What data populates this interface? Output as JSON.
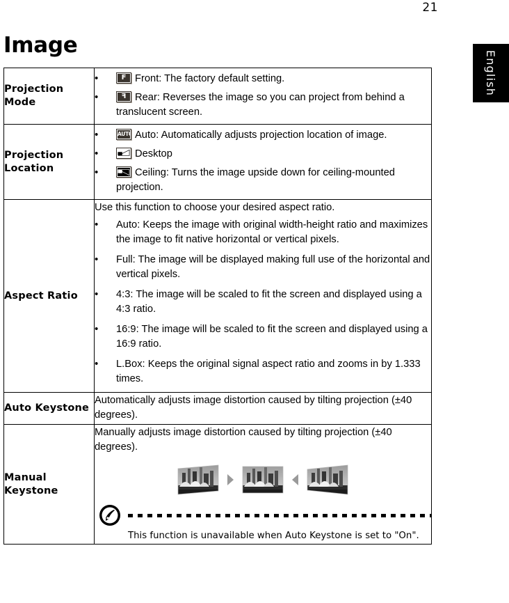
{
  "page": {
    "number": "21",
    "heading": "Image",
    "language_tab": "English"
  },
  "table": {
    "rows": [
      {
        "label": "Projection Mode",
        "bullets": [
          {
            "icon": "projector-front-icon",
            "icon_text": "F",
            "text": "Front: The factory default setting."
          },
          {
            "icon": "projector-rear-icon",
            "icon_text": "F",
            "text": "Rear: Reverses the image so you can project from behind a translucent screen."
          }
        ]
      },
      {
        "label": "Projection Location",
        "bullets": [
          {
            "icon": "projection-auto-icon",
            "icon_text": "AUTO",
            "text": "Auto: Automatically adjusts projection location of image."
          },
          {
            "icon": "projection-desktop-icon",
            "icon_text": "",
            "text": "Desktop"
          },
          {
            "icon": "projection-ceiling-icon",
            "icon_text": "",
            "text": "Ceiling: Turns the image upside down for ceiling-mounted projection."
          }
        ]
      },
      {
        "label": "Aspect  Ratio",
        "intro": "Use this function to choose your desired aspect ratio.",
        "bullets": [
          {
            "text": "Auto: Keeps the image with original width-height ratio and maximizes the image to fit native horizontal or vertical pixels."
          },
          {
            "text": "Full: The image will be displayed making full use of the horizontal and vertical pixels."
          },
          {
            "text": "4:3: The image will be scaled to fit the screen and displayed using a 4:3 ratio."
          },
          {
            "text": "16:9: The image will be scaled to fit the screen and displayed using a 16:9 ratio."
          },
          {
            "text": "L.Box: Keeps the original signal aspect ratio and zooms in by 1.333 times."
          }
        ]
      },
      {
        "label": "Auto Keystone",
        "intro": "Automatically adjusts image distortion caused by tilting projection (±40 degrees)."
      },
      {
        "label": "Manual Keystone",
        "intro": "Manually adjusts image distortion caused by tilting projection (±40 degrees).",
        "keystone_images": [
          {
            "name": "keystone-distorted-left-image"
          },
          {
            "name": "keystone-arrow-right-icon"
          },
          {
            "name": "keystone-corrected-image"
          },
          {
            "name": "keystone-arrow-left-icon"
          },
          {
            "name": "keystone-distorted-right-image"
          }
        ],
        "note": {
          "icon": "acer-note-icon",
          "text": "This function is unavailable when Auto Keystone is set to \"On\"."
        }
      }
    ]
  },
  "colors": {
    "border": "#000000",
    "icon_dark": "#3a342e",
    "arrow_gray": "#9a9a9a",
    "tab_background": "#000000",
    "tab_text": "#ffffff"
  }
}
